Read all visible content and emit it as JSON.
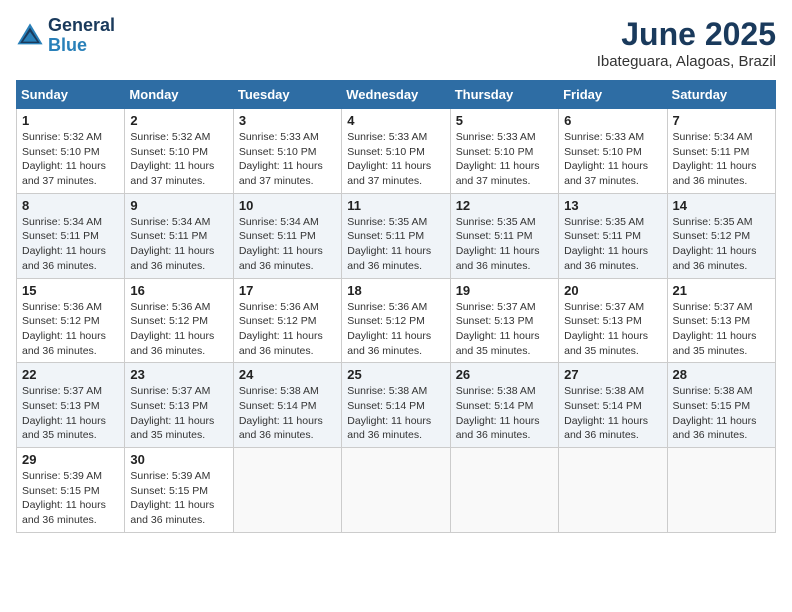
{
  "logo": {
    "line1": "General",
    "line2": "Blue"
  },
  "title": "June 2025",
  "subtitle": "Ibateguara, Alagoas, Brazil",
  "days_of_week": [
    "Sunday",
    "Monday",
    "Tuesday",
    "Wednesday",
    "Thursday",
    "Friday",
    "Saturday"
  ],
  "weeks": [
    [
      {
        "day": "1",
        "info": "Sunrise: 5:32 AM\nSunset: 5:10 PM\nDaylight: 11 hours\nand 37 minutes."
      },
      {
        "day": "2",
        "info": "Sunrise: 5:32 AM\nSunset: 5:10 PM\nDaylight: 11 hours\nand 37 minutes."
      },
      {
        "day": "3",
        "info": "Sunrise: 5:33 AM\nSunset: 5:10 PM\nDaylight: 11 hours\nand 37 minutes."
      },
      {
        "day": "4",
        "info": "Sunrise: 5:33 AM\nSunset: 5:10 PM\nDaylight: 11 hours\nand 37 minutes."
      },
      {
        "day": "5",
        "info": "Sunrise: 5:33 AM\nSunset: 5:10 PM\nDaylight: 11 hours\nand 37 minutes."
      },
      {
        "day": "6",
        "info": "Sunrise: 5:33 AM\nSunset: 5:10 PM\nDaylight: 11 hours\nand 37 minutes."
      },
      {
        "day": "7",
        "info": "Sunrise: 5:34 AM\nSunset: 5:11 PM\nDaylight: 11 hours\nand 36 minutes."
      }
    ],
    [
      {
        "day": "8",
        "info": "Sunrise: 5:34 AM\nSunset: 5:11 PM\nDaylight: 11 hours\nand 36 minutes."
      },
      {
        "day": "9",
        "info": "Sunrise: 5:34 AM\nSunset: 5:11 PM\nDaylight: 11 hours\nand 36 minutes."
      },
      {
        "day": "10",
        "info": "Sunrise: 5:34 AM\nSunset: 5:11 PM\nDaylight: 11 hours\nand 36 minutes."
      },
      {
        "day": "11",
        "info": "Sunrise: 5:35 AM\nSunset: 5:11 PM\nDaylight: 11 hours\nand 36 minutes."
      },
      {
        "day": "12",
        "info": "Sunrise: 5:35 AM\nSunset: 5:11 PM\nDaylight: 11 hours\nand 36 minutes."
      },
      {
        "day": "13",
        "info": "Sunrise: 5:35 AM\nSunset: 5:11 PM\nDaylight: 11 hours\nand 36 minutes."
      },
      {
        "day": "14",
        "info": "Sunrise: 5:35 AM\nSunset: 5:12 PM\nDaylight: 11 hours\nand 36 minutes."
      }
    ],
    [
      {
        "day": "15",
        "info": "Sunrise: 5:36 AM\nSunset: 5:12 PM\nDaylight: 11 hours\nand 36 minutes."
      },
      {
        "day": "16",
        "info": "Sunrise: 5:36 AM\nSunset: 5:12 PM\nDaylight: 11 hours\nand 36 minutes."
      },
      {
        "day": "17",
        "info": "Sunrise: 5:36 AM\nSunset: 5:12 PM\nDaylight: 11 hours\nand 36 minutes."
      },
      {
        "day": "18",
        "info": "Sunrise: 5:36 AM\nSunset: 5:12 PM\nDaylight: 11 hours\nand 36 minutes."
      },
      {
        "day": "19",
        "info": "Sunrise: 5:37 AM\nSunset: 5:13 PM\nDaylight: 11 hours\nand 35 minutes."
      },
      {
        "day": "20",
        "info": "Sunrise: 5:37 AM\nSunset: 5:13 PM\nDaylight: 11 hours\nand 35 minutes."
      },
      {
        "day": "21",
        "info": "Sunrise: 5:37 AM\nSunset: 5:13 PM\nDaylight: 11 hours\nand 35 minutes."
      }
    ],
    [
      {
        "day": "22",
        "info": "Sunrise: 5:37 AM\nSunset: 5:13 PM\nDaylight: 11 hours\nand 35 minutes."
      },
      {
        "day": "23",
        "info": "Sunrise: 5:37 AM\nSunset: 5:13 PM\nDaylight: 11 hours\nand 35 minutes."
      },
      {
        "day": "24",
        "info": "Sunrise: 5:38 AM\nSunset: 5:14 PM\nDaylight: 11 hours\nand 36 minutes."
      },
      {
        "day": "25",
        "info": "Sunrise: 5:38 AM\nSunset: 5:14 PM\nDaylight: 11 hours\nand 36 minutes."
      },
      {
        "day": "26",
        "info": "Sunrise: 5:38 AM\nSunset: 5:14 PM\nDaylight: 11 hours\nand 36 minutes."
      },
      {
        "day": "27",
        "info": "Sunrise: 5:38 AM\nSunset: 5:14 PM\nDaylight: 11 hours\nand 36 minutes."
      },
      {
        "day": "28",
        "info": "Sunrise: 5:38 AM\nSunset: 5:15 PM\nDaylight: 11 hours\nand 36 minutes."
      }
    ],
    [
      {
        "day": "29",
        "info": "Sunrise: 5:39 AM\nSunset: 5:15 PM\nDaylight: 11 hours\nand 36 minutes."
      },
      {
        "day": "30",
        "info": "Sunrise: 5:39 AM\nSunset: 5:15 PM\nDaylight: 11 hours\nand 36 minutes."
      },
      {
        "day": "",
        "info": ""
      },
      {
        "day": "",
        "info": ""
      },
      {
        "day": "",
        "info": ""
      },
      {
        "day": "",
        "info": ""
      },
      {
        "day": "",
        "info": ""
      }
    ]
  ]
}
